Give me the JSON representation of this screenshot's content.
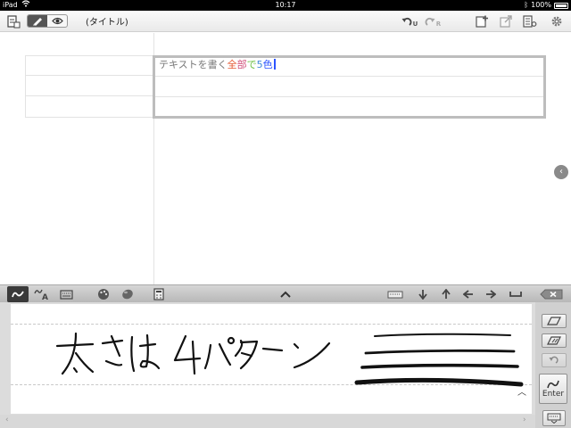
{
  "status_bar": {
    "device": "iPad",
    "time": "10:17",
    "battery": "100%"
  },
  "toolbar": {
    "title": "(タイトル)",
    "icons": [
      "document-list-icon",
      "pen-icon",
      "eye-icon",
      "undo-icon",
      "redo-icon",
      "add-page-icon",
      "export-icon",
      "list-settings-icon",
      "gear-icon"
    ],
    "undo_sub": "U",
    "redo_sub": "R"
  },
  "document": {
    "active_cell_text": "テキストを書く全部で5色",
    "text_colors": [
      "#777777",
      "#e4552f",
      "#d1507a",
      "#6bbf41",
      "#3c86d8",
      "#2b53ff"
    ]
  },
  "input_toolbar": {
    "icons": [
      "handwriting-icon",
      "handwriting-to-text-icon",
      "keyboard-input-icon",
      "palette-icon",
      "color-blob-icon",
      "calculator-icon",
      "collapse-arrow-icon",
      "space-key-icon",
      "arrow-down-icon",
      "arrow-up-icon",
      "arrow-left-icon",
      "arrow-right-icon",
      "space-icon",
      "delete-icon"
    ]
  },
  "handwriting_panel": {
    "handwritten_text": "太さは4パターン",
    "stroke_samples": 4,
    "enter_label": "Enter"
  },
  "colors": {
    "accent_cursor": "#2b53ff",
    "toolbar_bg": "#eeeeee",
    "panel_bg": "#d8d8d8"
  }
}
